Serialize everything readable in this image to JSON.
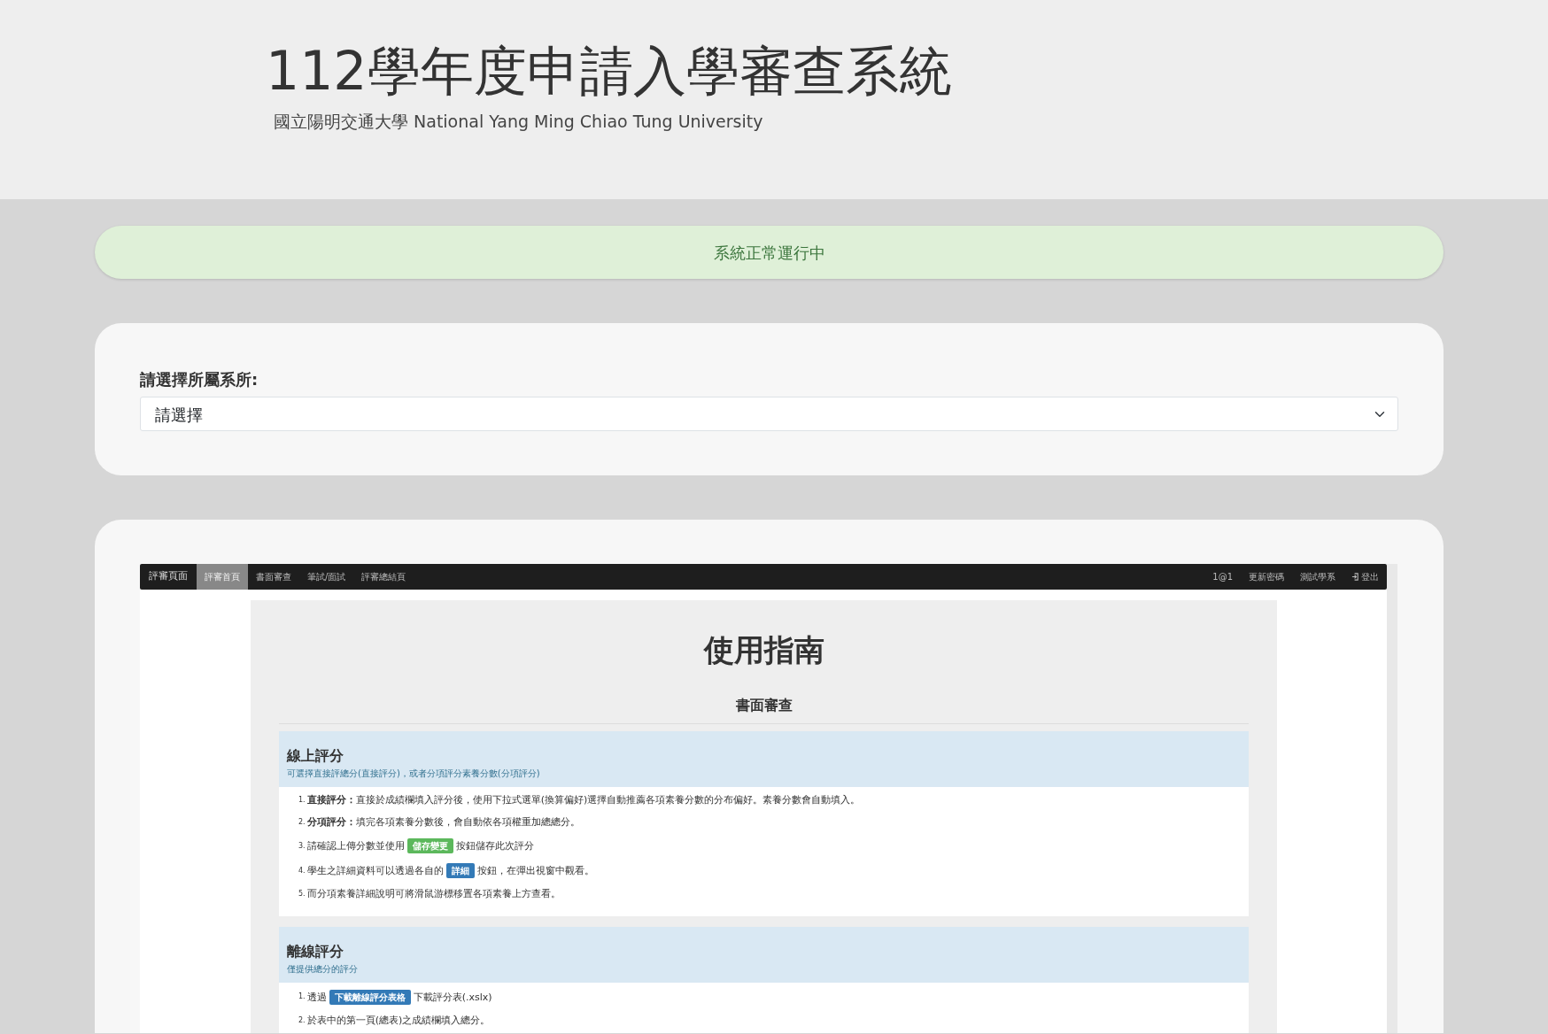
{
  "header": {
    "title": "112學年度申請入學審查系統",
    "subtitle": "國立陽明交通大學 National Yang Ming Chiao Tung University"
  },
  "status_alert": "系統正常運行中",
  "department_select": {
    "label": "請選擇所屬系所:",
    "value": "請選擇"
  },
  "preview": {
    "navbar": {
      "brand": "評審頁面",
      "items": [
        {
          "label": "評審首頁",
          "selected": true
        },
        {
          "label": "書面審查",
          "selected": false
        },
        {
          "label": "筆試/面試",
          "selected": false
        },
        {
          "label": "評審總結頁",
          "selected": false
        }
      ],
      "right_items": [
        {
          "label": "1@1",
          "kind": "text"
        },
        {
          "label": "更新密碼",
          "kind": "text"
        },
        {
          "label": "測試學系",
          "kind": "text"
        },
        {
          "label": "登出",
          "kind": "logout"
        }
      ]
    },
    "guide": {
      "title": "使用指南",
      "subtitle": "書面審查",
      "sections": [
        {
          "title": "線上評分",
          "subtitle": "可選擇直接評總分(直接評分)，或者分項評分素養分數(分項評分)",
          "items": [
            {
              "number": "1.",
              "segments": [
                {
                  "kind": "text",
                  "text": "**直接評分：**直接於成績欄填入評分後，使用下拉式選單(換算偏好)選擇自動推薦各項素養分數的分布偏好。素養分數會自動填入。"
                }
              ]
            },
            {
              "number": "2.",
              "segments": [
                {
                  "kind": "text",
                  "text": "**分項評分：**填完各項素養分數後，會自動依各項權重加總總分。"
                }
              ]
            },
            {
              "number": "3.",
              "segments": [
                {
                  "kind": "text",
                  "text": "請確認上傳分數並使用"
                },
                {
                  "kind": "button",
                  "text": "儲存變更",
                  "color": "#5cb85c"
                },
                {
                  "kind": "text",
                  "text": "按鈕儲存此次評分"
                }
              ]
            },
            {
              "number": "4.",
              "segments": [
                {
                  "kind": "text",
                  "text": "學生之詳細資料可以透過各自的"
                },
                {
                  "kind": "button",
                  "text": "詳細",
                  "color": "#337ab7"
                },
                {
                  "kind": "text",
                  "text": "按鈕，在彈出視窗中觀看。"
                }
              ]
            },
            {
              "number": "5.",
              "segments": [
                {
                  "kind": "text",
                  "text": "而分項素養詳細說明可將滑鼠游標移置各項素養上方查看。"
                }
              ]
            }
          ]
        },
        {
          "title": "離線評分",
          "subtitle": "僅提供總分的評分",
          "items": [
            {
              "number": "1.",
              "segments": [
                {
                  "kind": "text",
                  "text": "透過"
                },
                {
                  "kind": "button",
                  "text": "下載離線評分表格",
                  "color": "#337ab7"
                },
                {
                  "kind": "text",
                  "text": "下載評分表(.xslx)"
                }
              ]
            },
            {
              "number": "2.",
              "segments": [
                {
                  "kind": "text",
                  "text": "於表中的第一頁(總表)之成績欄填入總分。"
                }
              ]
            }
          ]
        }
      ]
    }
  }
}
